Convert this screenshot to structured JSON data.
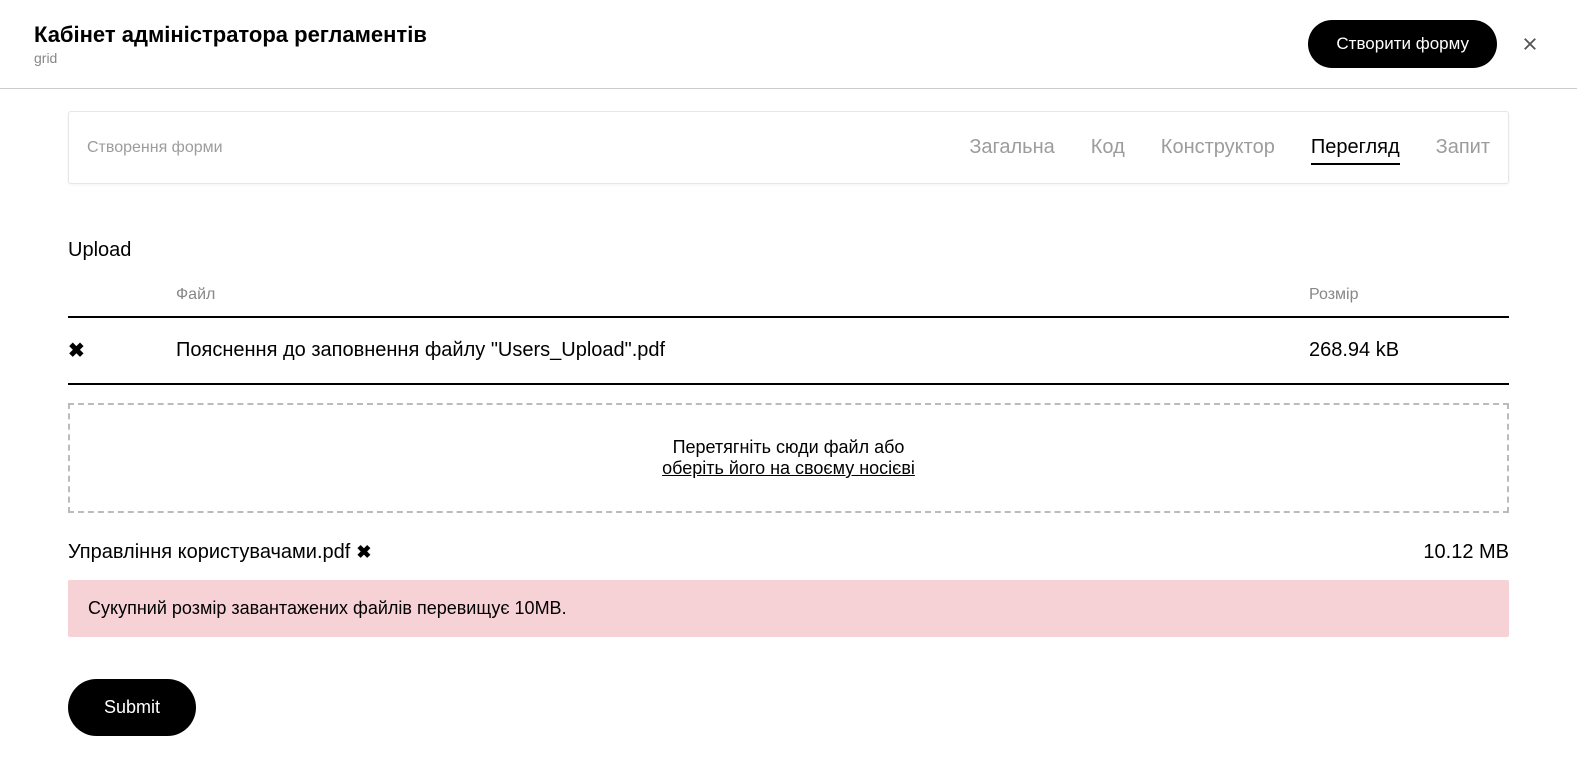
{
  "header": {
    "title": "Кабінет адміністратора регламентів",
    "subtitle": "grid",
    "create_button": "Створити форму"
  },
  "tabs": {
    "label": "Створення форми",
    "items": [
      {
        "label": "Загальна",
        "active": false
      },
      {
        "label": "Код",
        "active": false
      },
      {
        "label": "Конструктор",
        "active": false
      },
      {
        "label": "Перегляд",
        "active": true
      },
      {
        "label": "Запит",
        "active": false
      }
    ]
  },
  "upload": {
    "section_label": "Upload",
    "headers": {
      "file": "Файл",
      "size": "Розмір"
    },
    "files": [
      {
        "name": "Пояснення до заповнення файлу \"Users_Upload\".pdf",
        "size": "268.94 kB"
      }
    ],
    "dropzone": {
      "text": "Перетягніть сюди файл або",
      "link": "оберіть його на своєму носієві"
    },
    "secondary_file": {
      "name": "Управління користувачами.pdf",
      "size": "10.12 MB"
    },
    "error": "Сукупний розмір завантажених файлів перевищує 10МВ."
  },
  "submit_label": "Submit"
}
